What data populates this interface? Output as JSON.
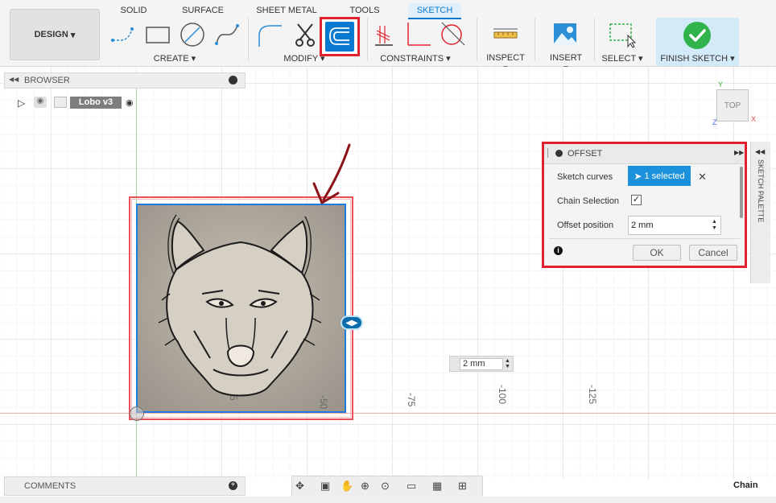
{
  "toolbar": {
    "design_label": "DESIGN",
    "tabs": [
      "SOLID",
      "SURFACE",
      "SHEET METAL",
      "TOOLS",
      "SKETCH"
    ],
    "groups": {
      "create": "CREATE",
      "modify": "MODIFY",
      "constraints": "CONSTRAINTS",
      "inspect": "INSPECT",
      "insert": "INSERT",
      "select": "SELECT",
      "finish": "FINISH SKETCH"
    },
    "colors": {
      "active_tab": "#0a7ad0",
      "highlight": "#e32230",
      "finish_bg": "#d3eaf8",
      "finish_check": "#2fb34a"
    }
  },
  "browser": {
    "title": "BROWSER",
    "item_label": "Lobo v3"
  },
  "comments": {
    "title": "COMMENTS"
  },
  "viewcube": {
    "face": "TOP",
    "x_axis": "X",
    "y_axis": "Y",
    "z_axis": "Z"
  },
  "offset_dialog": {
    "title": "OFFSET",
    "sketch_curves_label": "Sketch curves",
    "selection_label": "1 selected",
    "chain_selection_label": "Chain Selection",
    "chain_selection_checked": true,
    "offset_position_label": "Offset position",
    "offset_position_value": "2 mm",
    "ok_label": "OK",
    "cancel_label": "Cancel"
  },
  "sketch_palette_label": "SKETCH PALETTE",
  "canvas": {
    "dimension_input_value": "2 mm",
    "axis_ticks": [
      "-50",
      "-75",
      "-100",
      "-125"
    ],
    "partial_tick": "5"
  },
  "status": {
    "chain_label": "Chain"
  }
}
